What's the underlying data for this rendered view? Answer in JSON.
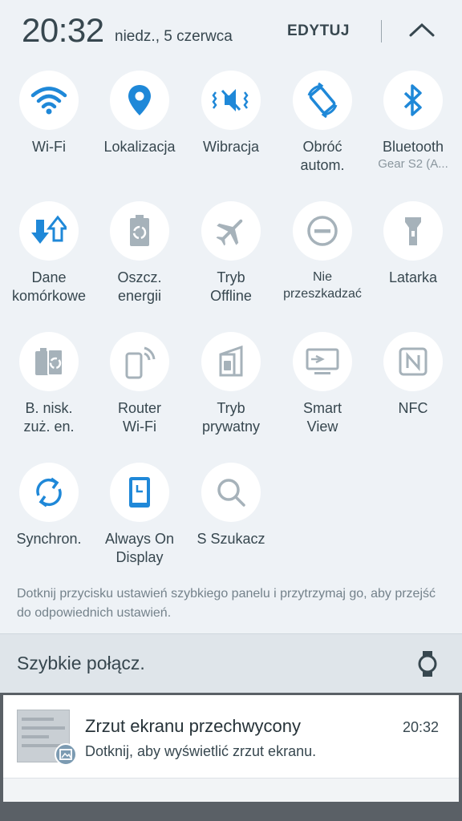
{
  "header": {
    "time": "20:32",
    "date": "niedz., 5 czerwca",
    "edit_label": "EDYTUJ"
  },
  "tiles": [
    {
      "label": "Wi-Fi",
      "icon": "wifi-icon",
      "active": true
    },
    {
      "label": "Lokalizacja",
      "icon": "location-pin-icon",
      "active": true
    },
    {
      "label": "Wibracja",
      "icon": "vibrate-icon",
      "active": true
    },
    {
      "label": "Obróć\nautom.",
      "icon": "auto-rotate-icon",
      "active": true
    },
    {
      "label": "Bluetooth",
      "sub": "Gear S2 (A...",
      "icon": "bluetooth-icon",
      "active": true
    },
    {
      "label": "Dane\nkomórkowe",
      "icon": "mobile-data-icon",
      "active": true
    },
    {
      "label": "Oszcz.\nenergii",
      "icon": "power-saving-icon",
      "active": false
    },
    {
      "label": "Tryb\nOffline",
      "icon": "airplane-icon",
      "active": false
    },
    {
      "label": "Nie\nprzeszkadzać",
      "icon": "do-not-disturb-icon",
      "active": false
    },
    {
      "label": "Latarka",
      "icon": "flashlight-icon",
      "active": false
    },
    {
      "label": "B. nisk.\nzuż. en.",
      "icon": "ultra-power-saving-icon",
      "active": false
    },
    {
      "label": "Router\nWi-Fi",
      "icon": "hotspot-icon",
      "active": false
    },
    {
      "label": "Tryb\nprywatny",
      "icon": "private-mode-icon",
      "active": false
    },
    {
      "label": "Smart\nView",
      "icon": "smart-view-icon",
      "active": false
    },
    {
      "label": "NFC",
      "icon": "nfc-icon",
      "active": false
    },
    {
      "label": "Synchron.",
      "icon": "sync-icon",
      "active": true
    },
    {
      "label": "Always On\nDisplay",
      "icon": "always-on-display-icon",
      "active": true
    },
    {
      "label": "S Szukacz",
      "icon": "search-icon",
      "active": false
    }
  ],
  "hint": "Dotknij przycisku ustawień szybkiego panelu i przytrzymaj go, aby przejść do odpowiednich ustawień.",
  "quick_connect": {
    "title": "Szybkie połącz.",
    "icon": "watch-icon"
  },
  "notification": {
    "title": "Zrzut ekranu przechwycony",
    "text": "Dotknij, aby wyświetlić zrzut ekranu.",
    "time": "20:32"
  },
  "colors": {
    "active": "#1f88d8",
    "inactive": "#a6b2ba",
    "panel": "#eef2f6"
  }
}
